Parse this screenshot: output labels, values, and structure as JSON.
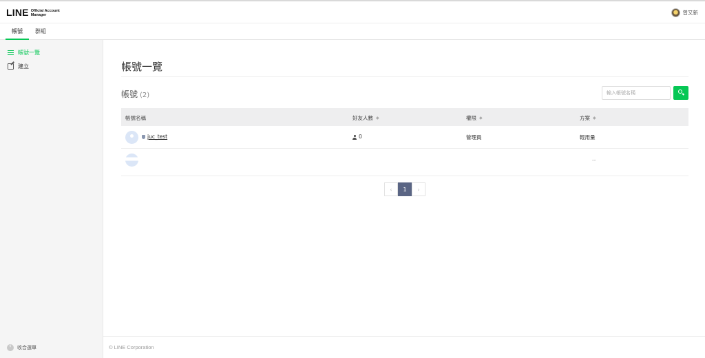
{
  "header": {
    "logo_main": "LINE",
    "logo_sub_1": "Official Account",
    "logo_sub_2": "Manager",
    "user_name": "曾又新"
  },
  "tabs": [
    {
      "label": "帳號",
      "active": true
    },
    {
      "label": "群組",
      "active": false
    }
  ],
  "sidebar": {
    "items": [
      {
        "label": "帳號一覽",
        "icon": "list-icon",
        "active": true
      },
      {
        "label": "建立",
        "icon": "edit-icon",
        "active": false
      }
    ],
    "collapse_label": "收合選單"
  },
  "main": {
    "page_title": "帳號一覽",
    "section_title": "帳號",
    "section_count": "(2)",
    "search_placeholder": "輸入帳號名稱",
    "table": {
      "headers": [
        "帳號名稱",
        "好友人數",
        "權限",
        "方案"
      ],
      "rows": [
        {
          "name": "juc_test",
          "friends": "0",
          "role": "管理員",
          "plan": "輕用量"
        },
        {
          "name": "",
          "friends": "",
          "role": "",
          "plan": "--"
        }
      ]
    },
    "pagination": {
      "prev": "‹",
      "current": "1",
      "next": "›"
    }
  },
  "footer": {
    "copyright": "© LINE Corporation"
  },
  "colors": {
    "accent": "#06c755",
    "pagination_active": "#5a6584"
  }
}
